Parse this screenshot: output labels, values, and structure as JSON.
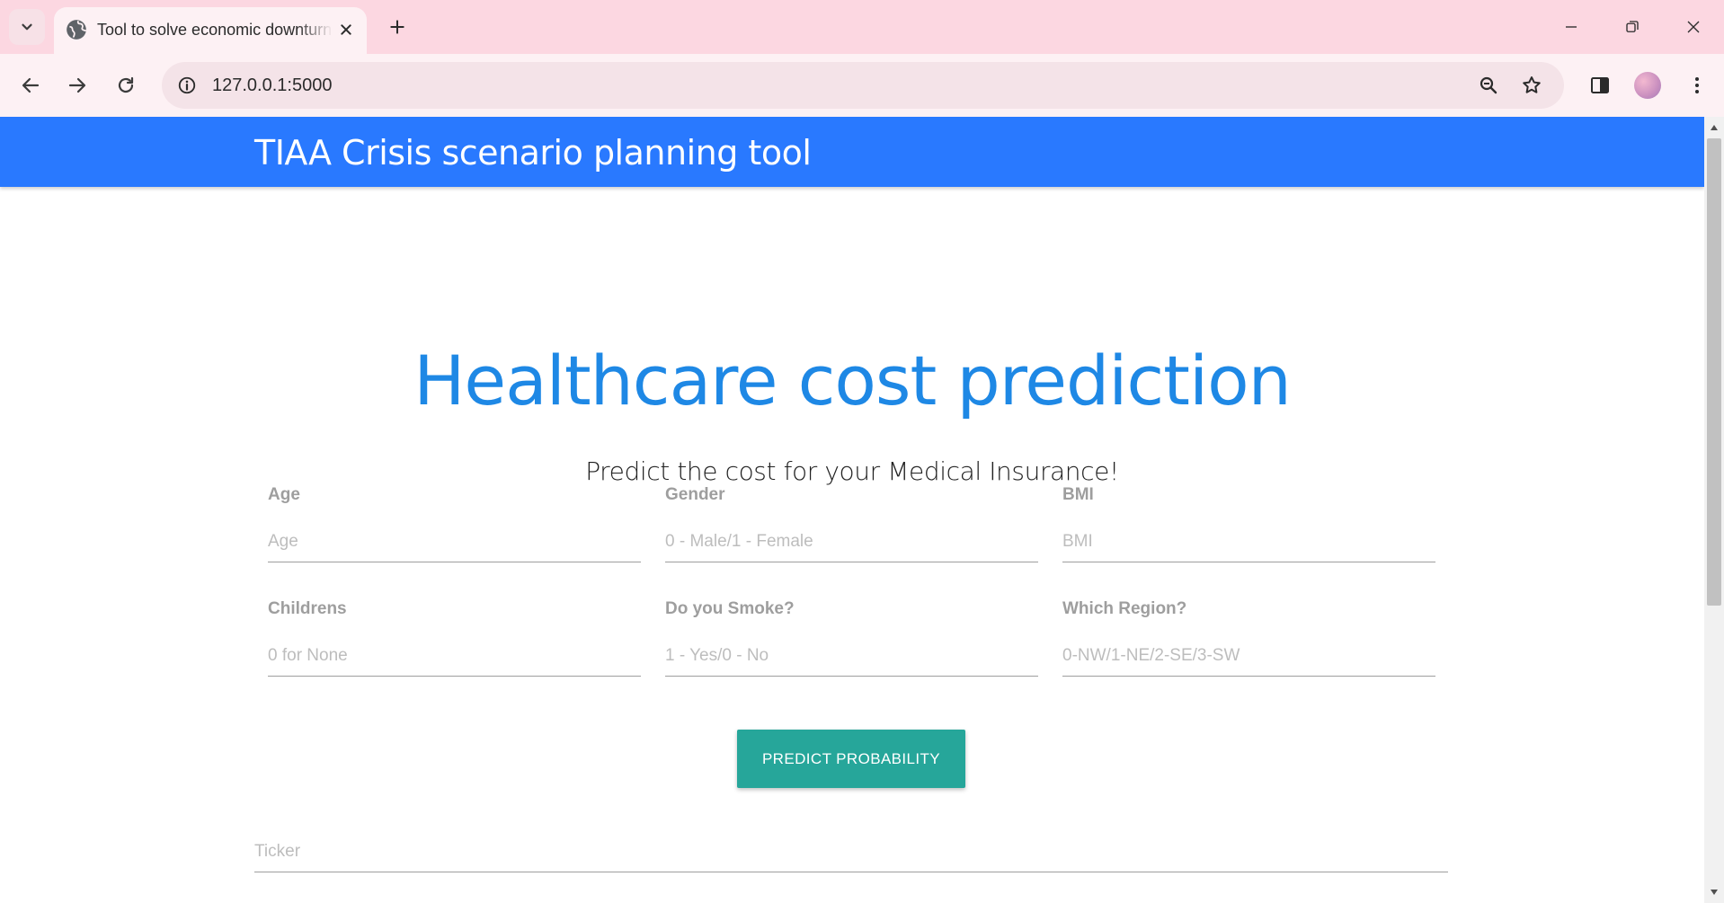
{
  "browser": {
    "tab_title": "Tool to solve economic downturn",
    "url": "127.0.0.1:5000"
  },
  "site": {
    "brand": "TIAA Crisis scenario planning tool",
    "title": "Healthcare cost prediction",
    "subtitle": "Predict the cost for your Medical Insurance!",
    "fields": [
      {
        "label": "Age",
        "placeholder": "Age",
        "value": ""
      },
      {
        "label": "Gender",
        "placeholder": "0 - Male/1 - Female",
        "value": ""
      },
      {
        "label": "BMI",
        "placeholder": "BMI",
        "value": ""
      },
      {
        "label": "Childrens",
        "placeholder": "0 for None",
        "value": ""
      },
      {
        "label": "Do you Smoke?",
        "placeholder": "1 - Yes/0 - No",
        "value": ""
      },
      {
        "label": "Which Region?",
        "placeholder": "0-NW/1-NE/2-SE/3-SW",
        "value": ""
      }
    ],
    "predict_button": "PREDICT PROBABILITY",
    "ticker": {
      "placeholder": "Ticker",
      "value": ""
    }
  },
  "colors": {
    "tabstrip": "#fcd7e1",
    "navbar": "#2979ff",
    "title": "#1e88e5",
    "button": "#26a69a"
  },
  "icons": {
    "tab_search": "chevron-down-icon",
    "favicon": "globe-icon",
    "tab_close": "close-icon",
    "new_tab": "plus-icon",
    "minimize": "minimize-icon",
    "restore": "restore-icon",
    "close_window": "close-icon",
    "back": "arrow-left-icon",
    "forward": "arrow-right-icon",
    "reload": "reload-icon",
    "site_info": "info-icon",
    "zoom": "zoom-icon",
    "bookmark": "star-icon",
    "side_panel": "side-panel-icon",
    "menu": "kebab-menu-icon"
  }
}
